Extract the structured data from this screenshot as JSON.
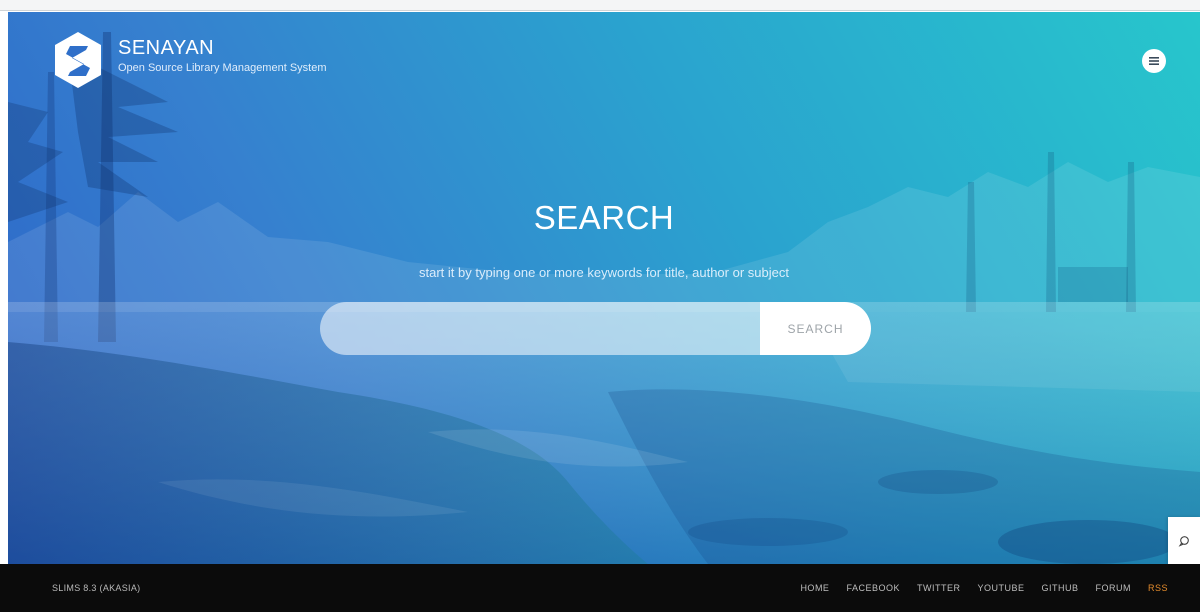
{
  "brand": {
    "name": "SENAYAN",
    "tagline": "Open Source Library Management System",
    "logo_icon": "senayan-s-hexagon-icon"
  },
  "header": {
    "menu_icon": "hamburger-menu-icon"
  },
  "search": {
    "title": "SEARCH",
    "hint": "start it by typing one or more keywords for title, author or subject",
    "input_value": "",
    "input_placeholder": "",
    "button_label": "SEARCH"
  },
  "chat": {
    "icon": "chat-bubble-icon"
  },
  "footer": {
    "version": "SLIMS 8.3 (AKASIA)",
    "links": [
      {
        "label": "HOME"
      },
      {
        "label": "FACEBOOK"
      },
      {
        "label": "TWITTER"
      },
      {
        "label": "YOUTUBE"
      },
      {
        "label": "GITHUB"
      },
      {
        "label": "FORUM"
      },
      {
        "label": "RSS",
        "color": "#e38b2c"
      }
    ]
  },
  "colors": {
    "hero_gradient_start": "#2b63c7",
    "hero_gradient_end": "#27c6cc",
    "footer_bg": "#0b0b0b",
    "rss_accent": "#e38b2c"
  }
}
